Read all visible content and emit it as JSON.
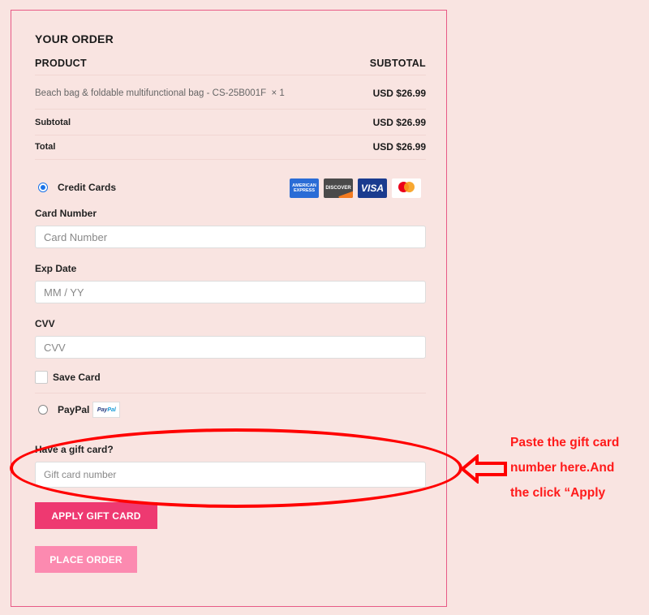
{
  "order": {
    "title": "YOUR ORDER",
    "header": {
      "product": "PRODUCT",
      "subtotal": "SUBTOTAL"
    },
    "items": [
      {
        "name": "Beach bag & foldable multifunctional bag - CS-25B001F",
        "qty": "× 1",
        "amount": "USD $26.99"
      }
    ],
    "subtotal": {
      "label": "Subtotal",
      "amount": "USD $26.99"
    },
    "total": {
      "label": "Total",
      "amount": "USD $26.99"
    }
  },
  "payment": {
    "credit_cards": {
      "label": "Credit Cards",
      "selected": true,
      "card_logos": [
        {
          "name": "american-express",
          "text": "AMERICAN EXPRESS"
        },
        {
          "name": "discover",
          "text": "DISCOVER"
        },
        {
          "name": "visa",
          "text": "VISA"
        },
        {
          "name": "mastercard",
          "text": "mastercard"
        }
      ]
    },
    "card_number": {
      "label": "Card Number",
      "placeholder": "Card Number",
      "value": ""
    },
    "exp_date": {
      "label": "Exp Date",
      "placeholder": "MM / YY",
      "value": ""
    },
    "cvv": {
      "label": "CVV",
      "placeholder": "CVV",
      "value": ""
    },
    "save_card": {
      "label": "Save Card",
      "checked": false
    },
    "paypal": {
      "label": "PayPal",
      "selected": false,
      "logo_text_1": "Pay",
      "logo_text_2": "Pal"
    }
  },
  "gift_card": {
    "label": "Have a gift card?",
    "placeholder": "Gift card number",
    "value": "",
    "apply_label": "APPLY GIFT CARD"
  },
  "place_order_label": "PLACE ORDER",
  "annotation": {
    "lines": [
      "Paste the gift card",
      "number here.And",
      "the click “Apply"
    ],
    "color": "#ff1a1a"
  },
  "colors": {
    "accent": "#ee3971",
    "accent_light": "#fc8ab0",
    "background": "#f9e4e1",
    "panel_border": "#e85a86"
  }
}
